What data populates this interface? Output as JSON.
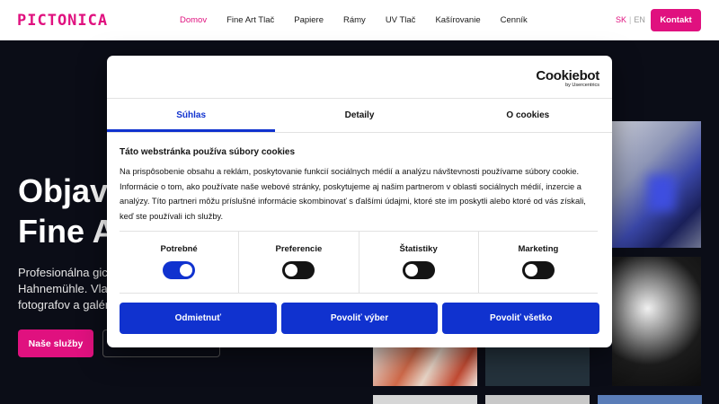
{
  "header": {
    "logo": "PICTONICA",
    "nav": [
      {
        "label": "Domov",
        "active": true
      },
      {
        "label": "Fine Art Tlač",
        "active": false
      },
      {
        "label": "Papiere",
        "active": false
      },
      {
        "label": "Rámy",
        "active": false
      },
      {
        "label": "UV Tlač",
        "active": false
      },
      {
        "label": "Kašírovanie",
        "active": false
      },
      {
        "label": "Cenník",
        "active": false
      }
    ],
    "lang_active": "SK",
    "lang_sep": "|",
    "lang_other": "EN",
    "contact_label": "Kontakt"
  },
  "hero": {
    "title_line1": "Objav",
    "title_line2": "Fine A",
    "sub_line1": "Profesionálna gicl",
    "sub_line2": "Hahnemühle. Vlas",
    "sub_line3": "fotografov a galér",
    "primary_button": "Naše služby"
  },
  "cookie_dialog": {
    "brand": "Cookiebot",
    "brand_by": "by Usercentrics",
    "tabs": [
      {
        "label": "Súhlas",
        "active": true
      },
      {
        "label": "Detaily",
        "active": false
      },
      {
        "label": "O cookies",
        "active": false
      }
    ],
    "title": "Táto webstránka používa súbory cookies",
    "body": "Na prispôsobenie obsahu a reklám, poskytovanie funkcií sociálnych médií a analýzu návštevnosti používame súbory cookie. Informácie o tom, ako používate naše webové stránky, poskytujeme aj našim partnerom v oblasti sociálnych médií, inzercie a analýzy. Títo partneri môžu príslušné informácie skombinovať s ďalšími údajmi, ktoré ste im poskytli alebo ktoré od vás získali, keď ste používali ich služby.",
    "toggles": [
      {
        "label": "Potrebné",
        "on": true
      },
      {
        "label": "Preferencie",
        "on": false
      },
      {
        "label": "Štatistiky",
        "on": false
      },
      {
        "label": "Marketing",
        "on": false
      }
    ],
    "buttons": {
      "deny": "Odmietnuť",
      "allow_selection": "Povoliť výber",
      "allow_all": "Povoliť všetko"
    }
  },
  "colors": {
    "brand_pink": "#e0117f",
    "cookiebot_blue": "#1032cf",
    "page_dark": "#0b0d17"
  }
}
